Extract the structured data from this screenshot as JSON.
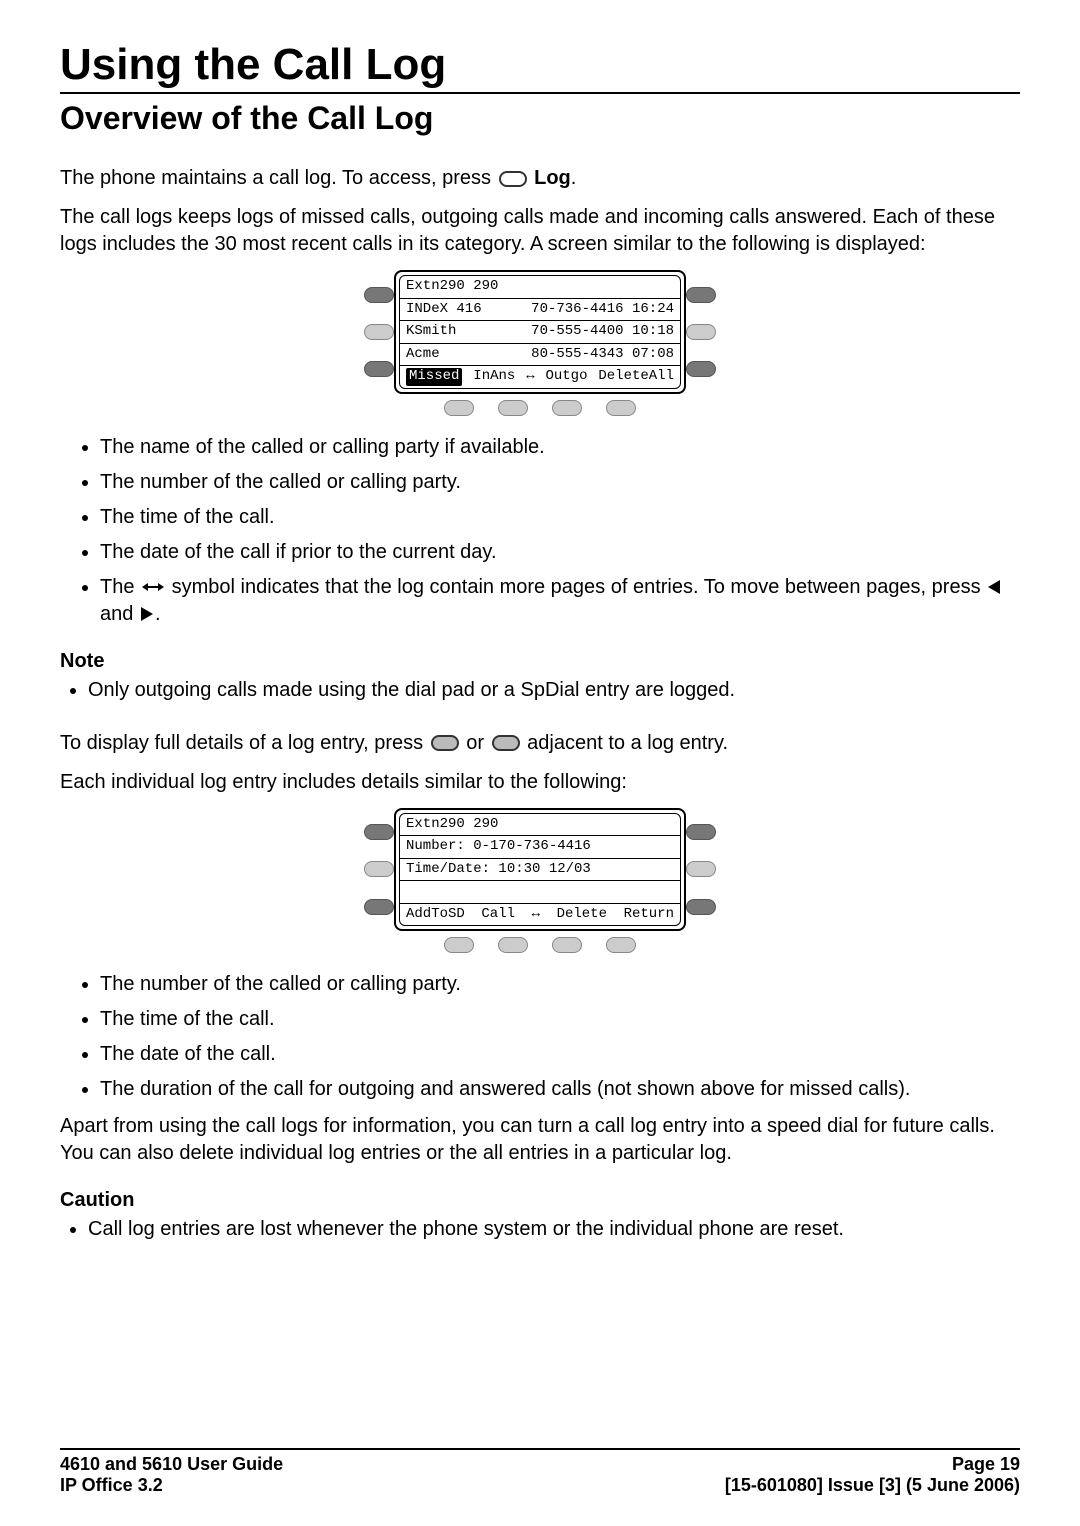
{
  "title": "Using the Call Log",
  "subtitle": "Overview of the Call Log",
  "intro1_pre": "The phone maintains a call log. To access, press ",
  "intro1_log": "Log",
  "intro1_post": ".",
  "intro2": "The call logs keeps logs of missed calls, outgoing calls made and incoming calls answered. Each of these logs includes the 30 most recent calls in its category. A screen similar to the following is displayed:",
  "screen1": {
    "header": "Extn290 290",
    "rows": [
      {
        "name": "INDeX 416",
        "detail": "70-736-4416 16:24"
      },
      {
        "name": "KSmith",
        "detail": "70-555-4400 10:18"
      },
      {
        "name": "Acme",
        "detail": "80-555-4343 07:08"
      }
    ],
    "actions": {
      "missed": "Missed",
      "inans": "InAns",
      "outgo": "Outgo",
      "deleteall": "DeleteAll"
    }
  },
  "list1": {
    "i1": "The name of the called or calling party if available.",
    "i2": "The number of the called or calling party.",
    "i3": "The time of the call.",
    "i4": "The date of the call if prior to the current day.",
    "i5_pre": "The ",
    "i5_mid": " symbol indicates that the log contain more pages of entries. To move between pages, press ",
    "i5_and": " and ",
    "i5_post": "."
  },
  "note_head": "Note",
  "note_item": "Only outgoing calls made using the dial pad or a SpDial entry are logged.",
  "detail_intro_pre": "To display full details of a log entry, press ",
  "detail_intro_mid": " or ",
  "detail_intro_post": " adjacent to a log entry.",
  "detail_intro2": "Each individual log entry includes details similar to the following:",
  "screen2": {
    "header": "Extn290 290",
    "number_line": "Number: 0-170-736-4416",
    "time_line": "Time/Date: 10:30 12/03",
    "actions": {
      "addtosd": "AddToSD",
      "call": "Call",
      "del": "Delete",
      "ret": "Return"
    }
  },
  "list2": {
    "i1": "The number of the called or calling party.",
    "i2": "The time of the call.",
    "i3": "The date of the call.",
    "i4": "The duration of the call for outgoing and answered calls (not shown above for missed calls)."
  },
  "closing": "Apart from using the call logs for information, you can turn a call log entry into a speed dial for future calls. You can also delete individual log entries or the all entries in a particular log.",
  "caution_head": "Caution",
  "caution_item": "Call log entries are lost whenever the phone system or the individual phone are reset.",
  "footer": {
    "left1": "4610 and 5610 User Guide",
    "right1": "Page 19",
    "left2": "IP Office 3.2",
    "right2": "[15-601080] Issue [3] (5 June 2006)"
  }
}
